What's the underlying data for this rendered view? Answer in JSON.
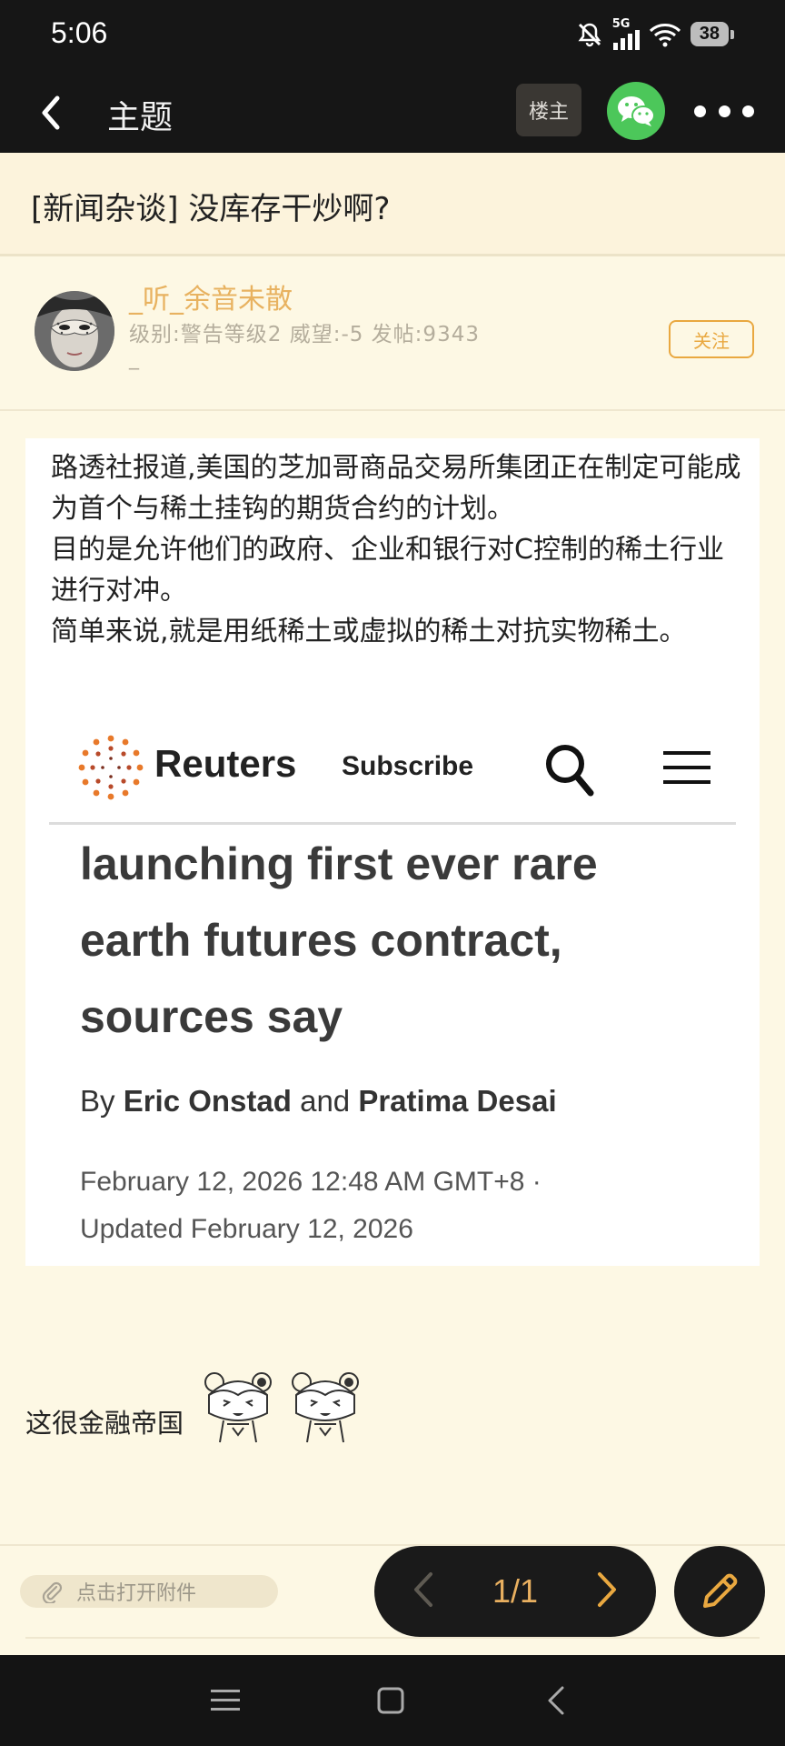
{
  "status_bar": {
    "time": "5:06",
    "network": "5G",
    "battery": "38"
  },
  "title_bar": {
    "title": "主题",
    "owner_label": "楼主"
  },
  "topic": {
    "title": "[新闻杂谈] 没库存干炒啊?"
  },
  "author": {
    "name": "_听_余音未散",
    "meta": "级别:警告等级2 威望:-5 发帖:9343",
    "signature": "_",
    "follow_label": "关注"
  },
  "post_image": {
    "paragraphs": [
      "路透社报道,美国的芝加哥商品交易所集团正在制定可能成为首个与稀土挂钩的期货合约的计划。",
      "目的是允许他们的政府、企业和银行对C控制的稀土行业进行对冲。",
      "简单来说,就是用纸稀土或虚拟的稀土对抗实物稀土。"
    ],
    "reuters_brand": "Reuters",
    "subscribe": "Subscribe",
    "headline_lines": [
      "launching first ever rare",
      "earth futures contract,",
      "sources say"
    ],
    "byline_by": "By ",
    "author_1": "Eric Onstad",
    "byline_and": " and ",
    "author_2": "Pratima Desai",
    "date": "February 12, 2026 12:48 AM GMT+8 ·",
    "updated": "Updated February 12, 2026"
  },
  "comment": {
    "text": "这很金融帝国"
  },
  "bottom": {
    "attachment_label": "点击打开附件",
    "page_indicator": "1/1"
  },
  "colors": {
    "accent": "#e9a840",
    "background": "#fdf8e4",
    "dark": "#161616",
    "wechat": "#4cc75a"
  }
}
